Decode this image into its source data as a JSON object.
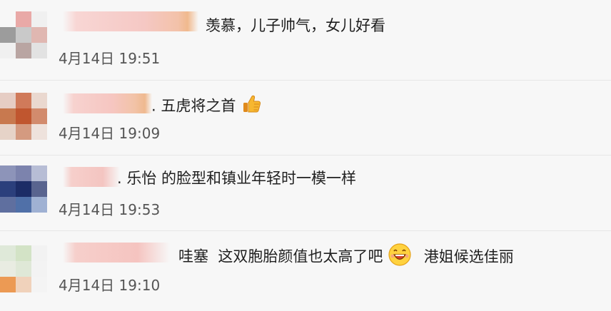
{
  "comments": [
    {
      "text": "羡慕，儿子帅气，女儿好看",
      "time": "4月14日 19:51",
      "avatar_colors": [
        "#f7f7f7",
        "#e9a9a7",
        "#f0f0f0",
        "#9c9c9c",
        "#c9c9c9",
        "#e0b7b1",
        "#f0f0f0",
        "#b9a5a2",
        "#e2e2e2"
      ],
      "name_color": "#f6c9c6"
    },
    {
      "text_prefix": ". 五虎将之首",
      "emoji": "thumbs-up-icon",
      "time": "4月14日 19:09",
      "avatar_colors": [
        "#e6cdc4",
        "#d07a5a",
        "#ead8cf",
        "#c8794f",
        "#c0562f",
        "#d28b6d",
        "#e6d3c8",
        "#d49a80",
        "#eee2dc"
      ],
      "name_color": "#f7c6c1"
    },
    {
      "text": ". 乐怡 的脸型和镇业年轻时一模一样",
      "time": "4月14日 19:53",
      "avatar_colors": [
        "#8d94b9",
        "#7c83ad",
        "#b7bdd5",
        "#2b3f7c",
        "#1c2c66",
        "#59648f",
        "#5f6f9f",
        "#5070a8",
        "#9fb1d3"
      ],
      "name_color": "#f4c5c1"
    },
    {
      "text_prefix": "哇塞  这双胞胎颜值也太高了吧",
      "emoji": "grinning-face-icon",
      "text_suffix": "港姐候选佳丽",
      "time": "4月14日 19:10",
      "avatar_colors": [
        "#dfe9d9",
        "#d3e3c6",
        "#f2f2f2",
        "#e9ece2",
        "#dfe8d7",
        "#f3f3f3",
        "#ec9a54",
        "#f0d2bb",
        "#f4f4f4"
      ],
      "name_color": "#f5c4c0"
    }
  ]
}
